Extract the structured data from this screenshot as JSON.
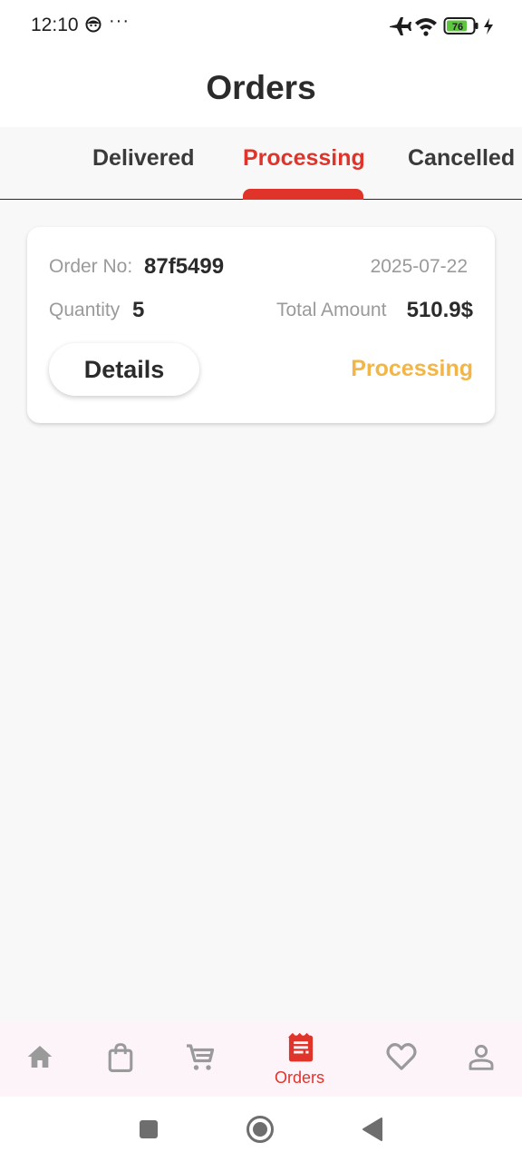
{
  "status_bar": {
    "time": "12:10",
    "dots": "···",
    "battery": "76"
  },
  "header": {
    "title": "Orders"
  },
  "tabs": [
    {
      "label": "Delivered",
      "active": false
    },
    {
      "label": "Processing",
      "active": true
    },
    {
      "label": "Cancelled",
      "active": false
    }
  ],
  "order": {
    "order_no_label": "Order No:",
    "order_no": "87f5499",
    "date": "2025-07-22",
    "quantity_label": "Quantity",
    "quantity": "5",
    "total_label": "Total Amount",
    "total": "510.9$",
    "details_label": "Details",
    "status": "Processing"
  },
  "bottom_nav": {
    "items": [
      {
        "icon": "home-icon"
      },
      {
        "icon": "shopping-bag-icon"
      },
      {
        "icon": "cart-icon"
      },
      {
        "icon": "orders-icon",
        "label": "Orders",
        "active": true
      },
      {
        "icon": "heart-icon"
      },
      {
        "icon": "profile-icon"
      }
    ]
  },
  "colors": {
    "accent": "#e0342a",
    "status_processing": "#f2b546",
    "text": "#2b2b2b",
    "muted": "#9a9a9a"
  }
}
